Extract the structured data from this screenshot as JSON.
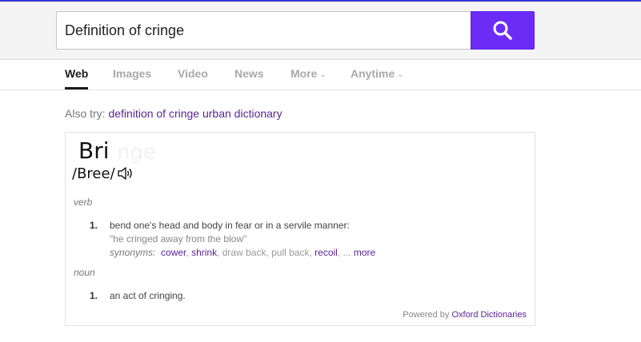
{
  "colors": {
    "accent": "#6b2cf6",
    "link": "#5b2596",
    "top_line": "#3a35d6"
  },
  "search": {
    "query": "Definition of cringe",
    "button_icon": "search-icon"
  },
  "tabs": [
    {
      "label": "Web",
      "active": true
    },
    {
      "label": "Images",
      "active": false
    },
    {
      "label": "Video",
      "active": false
    },
    {
      "label": "News",
      "active": false
    },
    {
      "label": "More",
      "active": false,
      "dropdown": true
    },
    {
      "label": "Anytime",
      "active": false,
      "dropdown": true
    }
  ],
  "also_try": {
    "prefix": "Also try:",
    "suggestion": "definition of cringe urban dictionary"
  },
  "definition": {
    "word": "Bri",
    "pronunciation": "/Bree/",
    "speaker_icon": "speaker-icon",
    "entries": [
      {
        "pos": "verb",
        "number": "1.",
        "definition": "bend one's head and body in fear or in a servile manner:",
        "example": "\"he cringed away from the blow\"",
        "synonyms_label": "synonyms:",
        "synonyms": [
          {
            "text": "cower",
            "link": true
          },
          {
            "text": "shrink",
            "link": true
          },
          {
            "text": "draw back",
            "link": false
          },
          {
            "text": "pull back",
            "link": false
          },
          {
            "text": "recoil",
            "link": true
          }
        ],
        "ellipsis": "...",
        "more": "more"
      },
      {
        "pos": "noun",
        "number": "1.",
        "definition": "an act of cringing."
      }
    ],
    "powered_by_prefix": "Powered by",
    "powered_by_link": "Oxford Dictionaries"
  }
}
